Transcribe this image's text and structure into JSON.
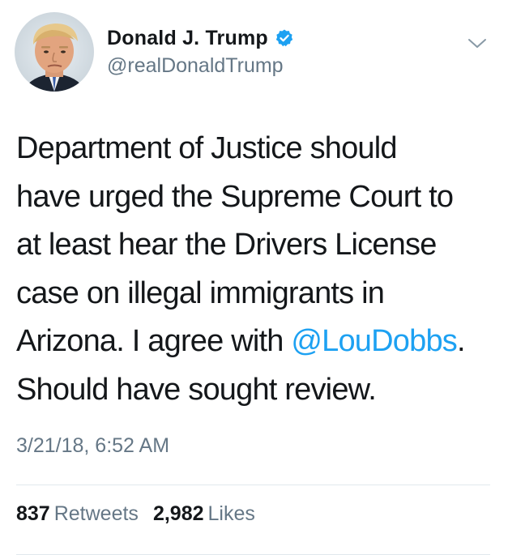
{
  "user": {
    "display_name": "Donald J. Trump",
    "handle": "@realDonaldTrump",
    "verified": true,
    "avatar_icon": "profile-photo"
  },
  "menu": {
    "icon": "chevron-down-icon"
  },
  "tweet": {
    "lines": [
      "Department of Justice should",
      "have urged the Supreme Court to",
      "at least hear the Drivers License",
      "case on illegal immigrants in"
    ],
    "line5_before": "Arizona. I agree with ",
    "mention": "@LouDobbs",
    "line5_after": ".",
    "line6": "Should have sought review."
  },
  "timestamp": "3/21/18, 6:52 AM",
  "stats": {
    "retweets_count": "837",
    "retweets_label": "Retweets",
    "likes_count": "2,982",
    "likes_label": "Likes"
  },
  "colors": {
    "text": "#14171a",
    "secondary": "#657786",
    "link": "#1da1f2",
    "divider": "#e1e8ed"
  }
}
